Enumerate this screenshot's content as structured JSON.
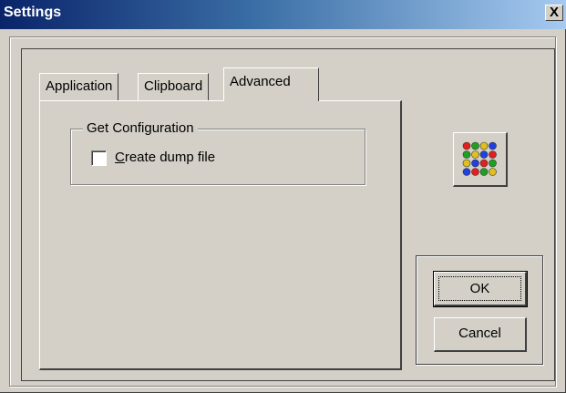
{
  "window": {
    "title": "Settings",
    "close_label": "X"
  },
  "tabs": [
    {
      "label": "Application",
      "active": false
    },
    {
      "label": "Clipboard",
      "active": false
    },
    {
      "label": "Advanced",
      "active": true
    }
  ],
  "advanced": {
    "group_title": "Get Configuration",
    "dump_checkbox": {
      "label_accel": "C",
      "label_rest": "reate dump file",
      "checked": false
    }
  },
  "app_icon": {
    "name": "colored-dots-grid-icon"
  },
  "buttons": {
    "ok": "OK",
    "cancel": "Cancel"
  },
  "colors": {
    "titlebar_start": "#0a246a",
    "titlebar_end": "#a6caf0",
    "face": "#d4d0c8"
  }
}
